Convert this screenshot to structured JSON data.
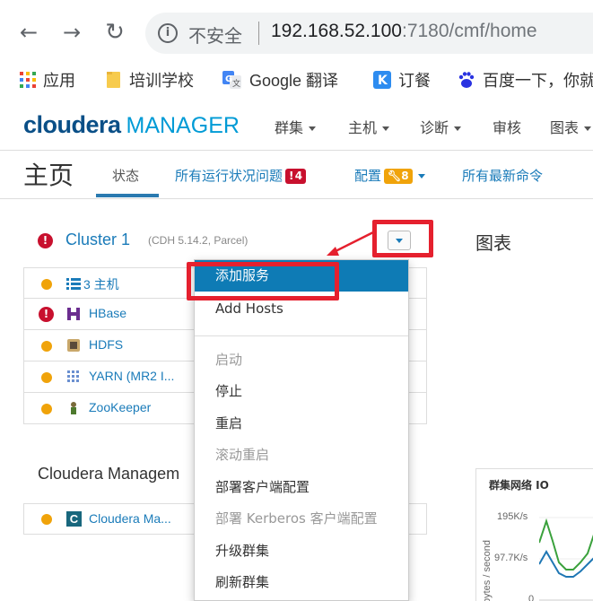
{
  "browser": {
    "insecure_label": "不安全",
    "url_host": "192.168.52.100",
    "url_rest": ":7180/cmf/home",
    "bookmarks": [
      {
        "label": "应用",
        "icon": "apps-grid-icon"
      },
      {
        "label": "培训学校",
        "icon": "folder-icon"
      },
      {
        "label": "Google 翻译",
        "icon": "google-translate-icon"
      },
      {
        "label": "订餐",
        "icon": "k-app-icon"
      },
      {
        "label": "百度一下，你就",
        "icon": "baidu-paw-icon"
      }
    ]
  },
  "header": {
    "logo_main": "cloudera",
    "logo_sub": "MANAGER",
    "nav": [
      "群集",
      "主机",
      "诊断",
      "审核",
      "图表"
    ]
  },
  "page": {
    "title": "主页",
    "tabs": {
      "status": "状态",
      "health_issues": "所有运行状况问题",
      "health_issues_count": "4",
      "config": "配置",
      "config_count": "8",
      "recent_commands": "所有最新命令"
    }
  },
  "cluster": {
    "name": "Cluster 1",
    "version": "(CDH 5.14.2, Parcel)",
    "services": [
      {
        "label": "3 主机",
        "status": "warning",
        "icon": "hosts-list-icon"
      },
      {
        "label": "HBase",
        "status": "error",
        "icon": "hbase-icon"
      },
      {
        "label": "HDFS",
        "status": "warning",
        "icon": "hdfs-icon"
      },
      {
        "label": "YARN (MR2 I...",
        "status": "warning",
        "icon": "yarn-icon"
      },
      {
        "label": "ZooKeeper",
        "status": "warning",
        "icon": "zookeeper-icon"
      }
    ]
  },
  "management": {
    "title": "Cloudera Managem",
    "service_label": "Cloudera Ma...",
    "service_icon_letter": "C"
  },
  "menu": {
    "items": [
      {
        "label": "添加服务",
        "state": "highlighted"
      },
      {
        "label": "Add Hosts",
        "state": "enabled"
      },
      {
        "label": "启动",
        "state": "disabled"
      },
      {
        "label": "停止",
        "state": "enabled"
      },
      {
        "label": "重启",
        "state": "enabled"
      },
      {
        "label": "滚动重启",
        "state": "disabled"
      },
      {
        "label": "部署客户端配置",
        "state": "enabled"
      },
      {
        "label": "部署 Kerberos 客户端配置",
        "state": "disabled"
      },
      {
        "label": "升级群集",
        "state": "enabled"
      },
      {
        "label": "刷新群集",
        "state": "enabled"
      }
    ]
  },
  "charts": {
    "section_title": "图表",
    "card_title": "群集网络 IO",
    "y_label": "bytes / second",
    "y_ticks": [
      "195K/s",
      "97.7K/s",
      "0"
    ]
  },
  "colors": {
    "accent": "#1a7bb9",
    "highlight": "#0e7bb5",
    "annotation_red": "#e5202e",
    "warning": "#f0a30a",
    "error": "#c8102e"
  }
}
